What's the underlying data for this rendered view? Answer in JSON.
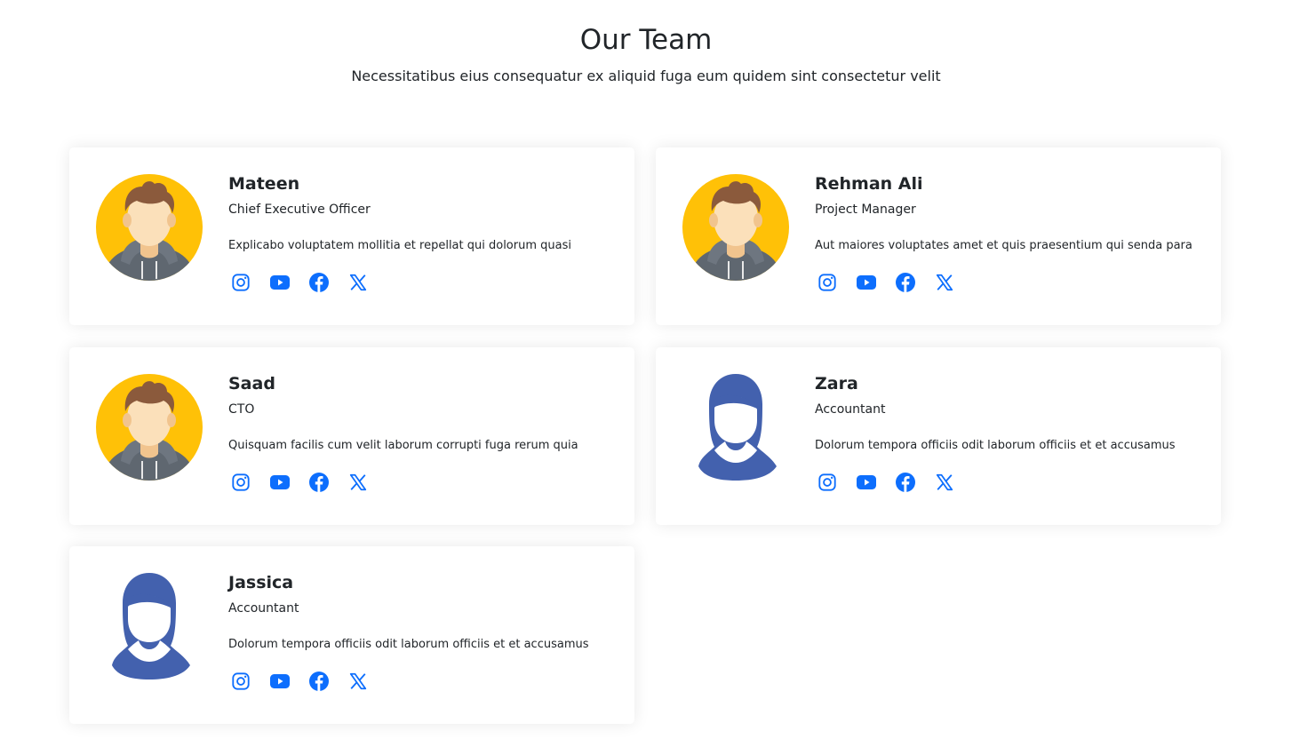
{
  "header": {
    "title": "Our Team",
    "subtitle": "Necessitatibus eius consequatur ex aliquid fuga eum quidem sint consectetur velit"
  },
  "colors": {
    "social_icon": "#0d6efd",
    "avatar_male_bg": "#FFC107",
    "avatar_female": "#4361AE"
  },
  "members": [
    {
      "name": "Mateen",
      "role": "Chief Executive Officer",
      "description": "Explicabo voluptatem mollitia et repellat qui dolorum quasi",
      "avatar": "male-avatar",
      "social": [
        "instagram-icon",
        "youtube-icon",
        "facebook-icon",
        "x-twitter-icon"
      ]
    },
    {
      "name": "Rehman Ali",
      "role": "Project Manager",
      "description": "Aut maiores voluptates amet et quis praesentium qui senda para",
      "avatar": "male-avatar",
      "social": [
        "instagram-icon",
        "youtube-icon",
        "facebook-icon",
        "x-twitter-icon"
      ]
    },
    {
      "name": "Saad",
      "role": "CTO",
      "description": "Quisquam facilis cum velit laborum corrupti fuga rerum quia",
      "avatar": "male-avatar",
      "social": [
        "instagram-icon",
        "youtube-icon",
        "facebook-icon",
        "x-twitter-icon"
      ]
    },
    {
      "name": "Zara",
      "role": "Accountant",
      "description": "Dolorum tempora officiis odit laborum officiis et et accusamus",
      "avatar": "female-avatar",
      "social": [
        "instagram-icon",
        "youtube-icon",
        "facebook-icon",
        "x-twitter-icon"
      ]
    },
    {
      "name": "Jassica",
      "role": "Accountant",
      "description": "Dolorum tempora officiis odit laborum officiis et et accusamus",
      "avatar": "female-avatar",
      "social": [
        "instagram-icon",
        "youtube-icon",
        "facebook-icon",
        "x-twitter-icon"
      ]
    }
  ]
}
